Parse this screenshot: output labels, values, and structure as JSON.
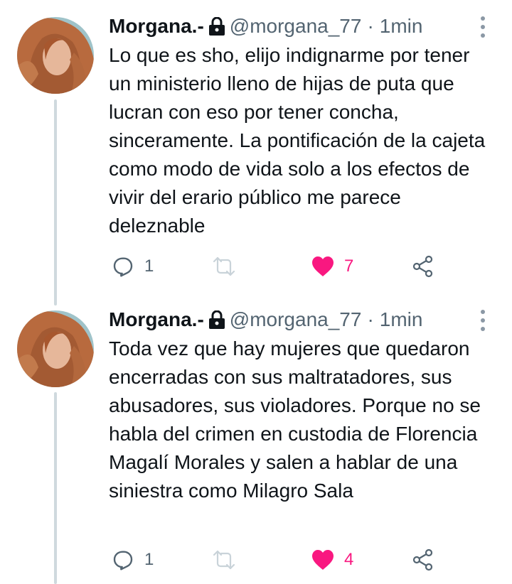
{
  "tweets": [
    {
      "display_name": "Morgana.-",
      "handle": "@morgana_77",
      "separator": "·",
      "time": "1min",
      "text": "Lo que es sho, elijo indignarme por tener un ministerio lleno de hijas de puta que lucran con eso por tener concha, sinceramente. La pontificación de la cajeta como modo de vida solo a los efectos de vivir del erario público me parece deleznable",
      "reply_count": "1",
      "like_count": "7"
    },
    {
      "display_name": "Morgana.-",
      "handle": "@morgana_77",
      "separator": "·",
      "time": "1min",
      "text": "Toda vez que hay mujeres que quedaron encerradas con sus maltratadores, sus abusadores, sus violadores. Porque no se habla del crimen en custodia de Florencia Magalí Morales y salen a hablar de una siniestra como Milagro Sala",
      "reply_count": "1",
      "like_count": "4"
    }
  ],
  "colors": {
    "text": "#0f1419",
    "secondary": "#536471",
    "like": "#f91880",
    "thread_line": "#cfd9de"
  },
  "icons": [
    "lock-icon",
    "more-icon",
    "reply-icon",
    "retweet-icon",
    "heart-filled-icon",
    "share-icon"
  ]
}
